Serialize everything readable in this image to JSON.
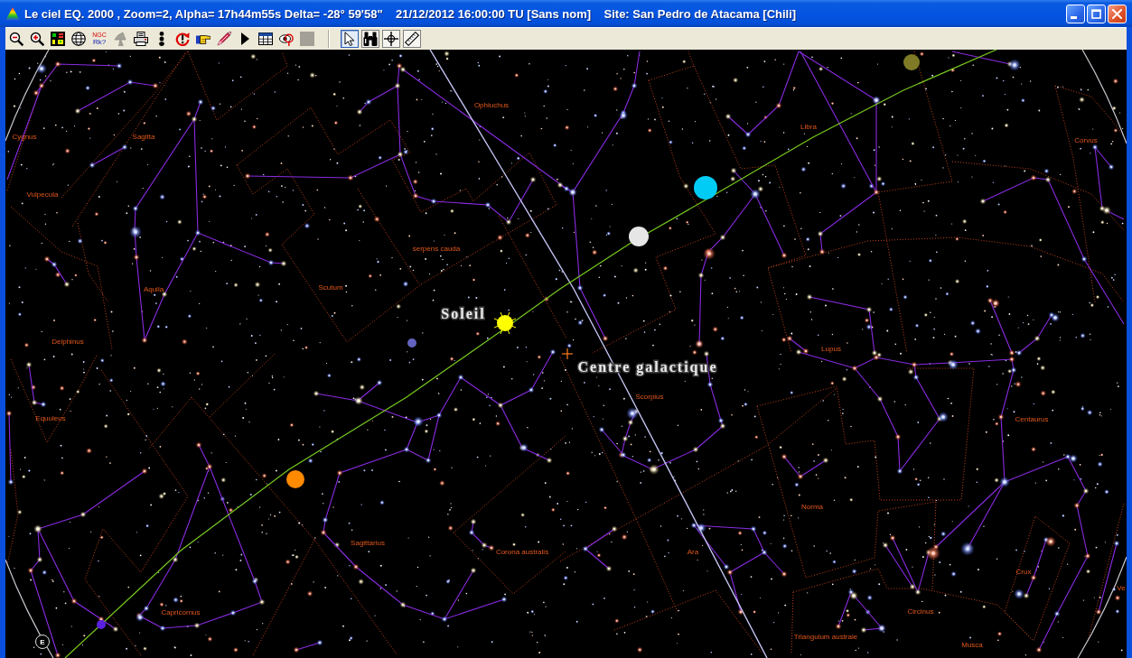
{
  "window": {
    "title": "Le ciel EQ. 2000 , Zoom=2, Alpha= 17h44m55s Delta= -28° 59'58\"    21/12/2012 16:00:00 TU [Sans nom]    Site: San Pedro de Atacama [Chili]"
  },
  "window_controls": [
    {
      "kind": "minimize"
    },
    {
      "kind": "maximize"
    },
    {
      "kind": "close"
    }
  ],
  "toolbar": [
    {
      "kind": "zoom_out",
      "disabled": false
    },
    {
      "kind": "zoom_in",
      "disabled": false
    },
    {
      "kind": "color_grid",
      "disabled": false
    },
    {
      "kind": "globe",
      "disabled": false
    },
    {
      "kind": "catalog",
      "lines": [
        "NGC",
        "Rk?"
      ],
      "disabled": false
    },
    {
      "kind": "satellite_dish",
      "disabled": true
    },
    {
      "kind": "printer",
      "disabled": false
    },
    {
      "kind": "stacked_dots",
      "disabled": false
    },
    {
      "kind": "refresh_alert",
      "disabled": false
    },
    {
      "kind": "pointing_hand",
      "disabled": false
    },
    {
      "kind": "pencil",
      "disabled": false
    },
    {
      "kind": "play",
      "disabled": false
    },
    {
      "kind": "table",
      "disabled": false
    },
    {
      "kind": "eye",
      "disabled": false
    },
    {
      "kind": "blank_square",
      "disabled": true
    }
  ],
  "tools": [
    {
      "kind": "pointer",
      "selected": true
    },
    {
      "kind": "binoculars",
      "selected": false
    },
    {
      "kind": "crosshair",
      "selected": false
    },
    {
      "kind": "ruler",
      "selected": false
    }
  ],
  "sky_map": {
    "constellations": [
      "Ophiuchus",
      "Libra",
      "Cygnus",
      "Sagitta",
      "Corvus",
      "Vulpecula",
      "serpens cauda",
      "Scutum",
      "Aquila",
      "Delphinus",
      "Lupus",
      "Scorpius",
      "Equuleus",
      "Centaurus",
      "Norma",
      "Sagittarius",
      "Corona australis",
      "Ara",
      "Crux",
      "Ve",
      "Circinus",
      "Capricornus",
      "Triangulum australe",
      "Musca"
    ],
    "sun": {
      "label": "Soleil"
    },
    "galactic_centre": {
      "label": "Centre galactique"
    },
    "planets": [
      {
        "color": "#7f7a26"
      },
      {
        "color": "#00ccf5"
      },
      {
        "color": "#e6e6e6"
      },
      {
        "color": "#6464c0"
      },
      {
        "color": "#ff8a00"
      },
      {
        "color": "#5a20e0"
      }
    ],
    "compass": "E"
  }
}
